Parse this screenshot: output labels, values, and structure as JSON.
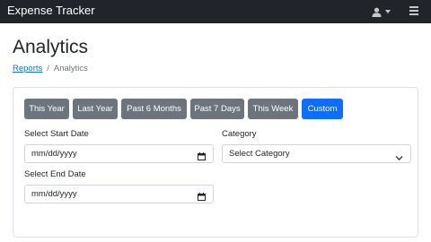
{
  "app": {
    "title": "Expense Tracker"
  },
  "navbar": {
    "user_icon": "user-icon",
    "caret_icon": "caret-down-icon",
    "menu_icon": "hamburger-menu-icon"
  },
  "page": {
    "title": "Analytics"
  },
  "breadcrumb": {
    "parent": "Reports",
    "separator": "/",
    "current": "Analytics"
  },
  "filters": {
    "buttons": [
      {
        "label": "This Year",
        "active": false
      },
      {
        "label": "Last Year",
        "active": false
      },
      {
        "label": "Past 6 Months",
        "active": false
      },
      {
        "label": "Past 7 Days",
        "active": false
      },
      {
        "label": "This Week",
        "active": false
      },
      {
        "label": "Custom",
        "active": true
      }
    ],
    "start_date": {
      "label": "Select Start Date",
      "placeholder": "mm/dd/yyyy"
    },
    "end_date": {
      "label": "Select End Date",
      "placeholder": "mm/dd/yyyy"
    },
    "category": {
      "label": "Category",
      "selected": "Select Category"
    }
  },
  "colors": {
    "navbar": "#212529",
    "primary": "#0d6efd",
    "secondary": "#6c757d",
    "link": "#0d6efd"
  }
}
